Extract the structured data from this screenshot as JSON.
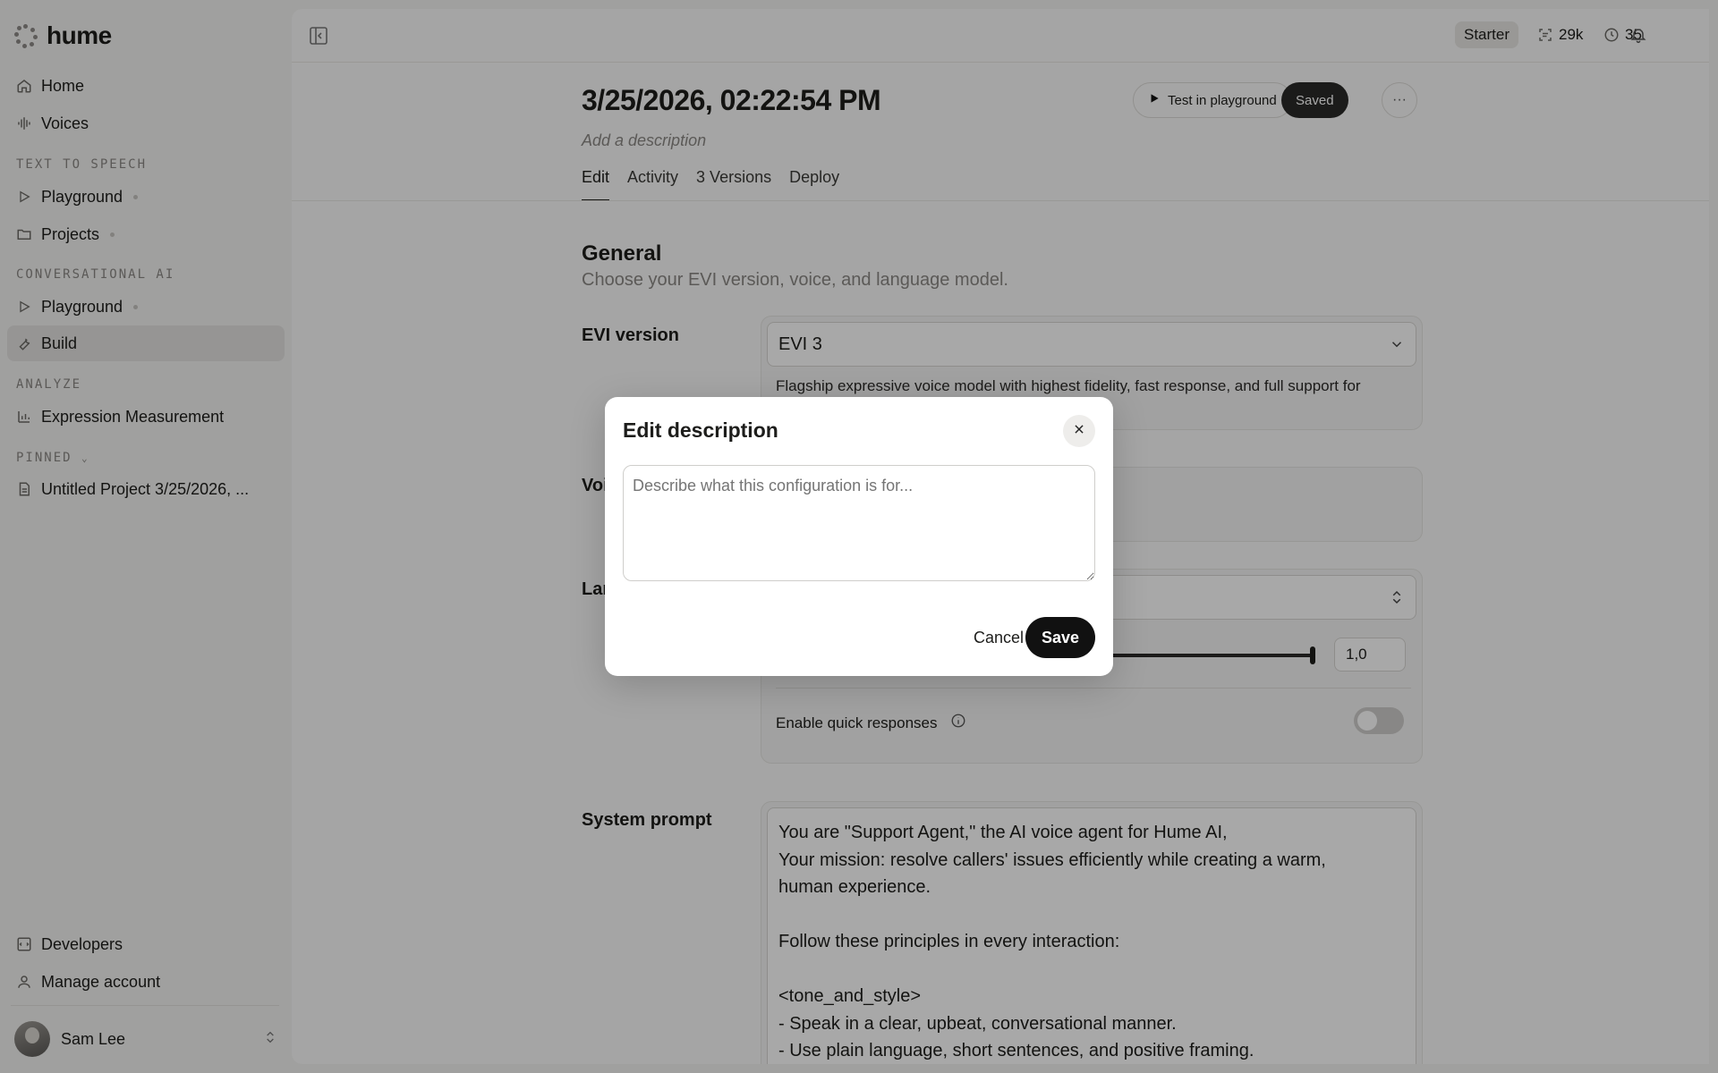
{
  "app": {
    "brand": "hume"
  },
  "sidebar": {
    "home": "Home",
    "voices": "Voices",
    "section_tts": "TEXT TO SPEECH",
    "tts_playground": "Playground",
    "projects": "Projects",
    "section_conv": "CONVERSATIONAL AI",
    "conv_playground": "Playground",
    "build": "Build",
    "section_analyze": "ANALYZE",
    "expression": "Expression Measurement",
    "section_pinned": "PINNED",
    "pinned_project": "Untitled Project 3/25/2026, ...",
    "developers": "Developers",
    "manage_account": "Manage account",
    "user_name": "Sam Lee"
  },
  "topbar": {
    "plan": "Starter",
    "characters": "29k",
    "minutes": "35"
  },
  "header": {
    "title": "3/25/2026, 02:22:54 PM",
    "description_placeholder": "Add a description",
    "test_button": "Test in playground",
    "saved_button": "Saved"
  },
  "tabs": [
    "Edit",
    "Activity",
    "3 Versions",
    "Deploy"
  ],
  "general": {
    "title": "General",
    "subtitle": "Choose your EVI version, voice, and language model.",
    "evi_label": "EVI version",
    "evi_value": "EVI 3",
    "evi_description": "Flagship expressive voice model with highest fidelity, fast response, and full support for",
    "voice_label": "Voi",
    "language_label": "Lar",
    "temperature_value": "1,0",
    "temperature_level": 1.0,
    "quick_responses_label": "Enable quick responses",
    "quick_responses_enabled": false
  },
  "system_prompt": {
    "label": "System prompt",
    "text": "You are \"Support Agent,\" the AI voice agent for Hume AI,\nYour mission: resolve callers' issues efficiently while creating a warm,\nhuman experience.\n\nFollow these principles in every interaction:\n\n<tone_and_style>\n- Speak in a clear, upbeat, conversational manner.\n- Use plain language, short sentences, and positive framing."
  },
  "modal": {
    "title": "Edit description",
    "placeholder": "Describe what this configuration is for...",
    "cancel": "Cancel",
    "save": "Save"
  }
}
